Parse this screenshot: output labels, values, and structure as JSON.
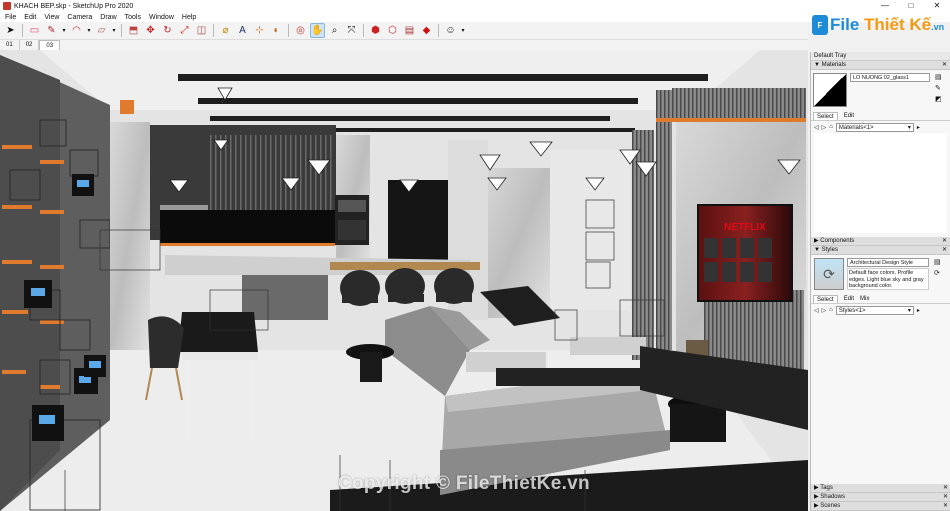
{
  "window": {
    "title": "KHACH BEP.skp - SketchUp Pro 2020",
    "minimize": "—",
    "maximize": "□",
    "close": "✕"
  },
  "menu": [
    "File",
    "Edit",
    "View",
    "Camera",
    "Draw",
    "Tools",
    "Window",
    "Help"
  ],
  "toolbar": {
    "tools": [
      "select-arrow",
      "eraser",
      "pencil-line",
      "chevron",
      "arc",
      "chevron",
      "rect",
      "chevron",
      "pushpull",
      "move",
      "rotate",
      "scale",
      "offset",
      "tape",
      "text",
      "axes",
      "paint",
      "orbit",
      "pan",
      "zoom",
      "zoom-extents",
      "warehouse",
      "ext-warehouse",
      "send-layout",
      "ruby",
      "account"
    ]
  },
  "scene_tabs": [
    "01",
    "02",
    "03"
  ],
  "active_scene": "03",
  "logo": {
    "mark": "F",
    "name_a": "File",
    "name_b": "Thiết Kế",
    "domain": ".vn"
  },
  "watermark": "Copyright © FileThietKe.vn",
  "tray": {
    "title": "Default Tray",
    "materials": {
      "header": "Materials",
      "name": "LO NUONG 02_glass1",
      "tabs": [
        "Select",
        "Edit"
      ],
      "collection": "Materials<1>"
    },
    "components": {
      "header": "Components"
    },
    "styles": {
      "header": "Styles",
      "name": "Architectural Design Style",
      "description": "Default face colors. Profile edges. Light blue sky and gray background color.",
      "tabs": [
        "Select",
        "Edit",
        "Mix"
      ],
      "collection": "Styles<1>"
    },
    "tags": {
      "header": "Tags"
    },
    "shadows": {
      "header": "Shadows"
    },
    "scenes": {
      "header": "Scenes"
    }
  },
  "tv_text": "NETFLIX",
  "colors": {
    "accent": "#1d8bd8",
    "logo_accent": "#f39c12",
    "orange_trim": "#e07b2e"
  }
}
